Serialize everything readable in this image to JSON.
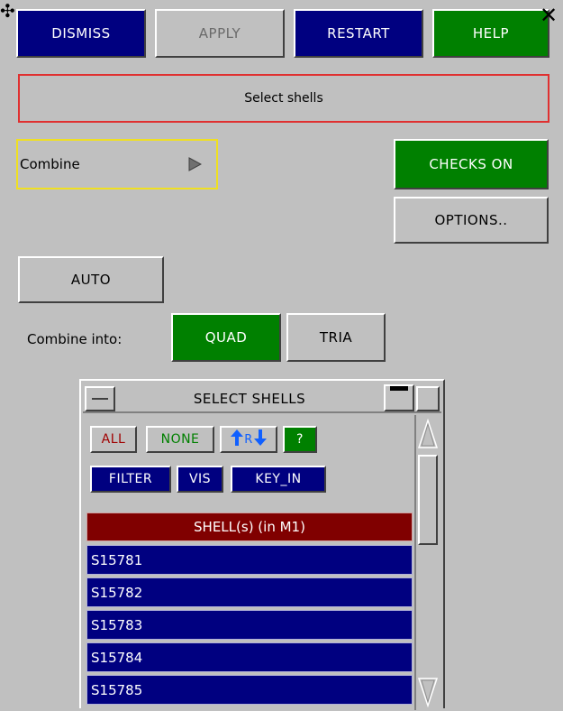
{
  "toolbar": {
    "dismiss": "DISMISS",
    "apply": "APPLY",
    "restart": "RESTART",
    "help": "HELP",
    "close_glyph": "✕",
    "move_glyph": "✣"
  },
  "header": {
    "select_shells": "Select shells"
  },
  "mode": {
    "value": "Combine"
  },
  "checks_button": "CHECKS ON",
  "options_button": "OPTIONS..",
  "auto_button": "AUTO",
  "combine": {
    "label": "Combine into:",
    "quad": "QUAD",
    "tria": "TRIA"
  },
  "selector": {
    "title": "SELECT SHELLS",
    "all": "ALL",
    "none": "NONE",
    "r_label": "R",
    "question": "?",
    "filter": "FILTER",
    "vis": "VIS",
    "key_in": "KEY_IN",
    "list_header": "SHELL(s) (in M1)",
    "items": [
      "S15781",
      "S15782",
      "S15783",
      "S15784",
      "S15785"
    ]
  },
  "colors": {
    "navy": "#000080",
    "green": "#008000",
    "panel": "#c0c0c0",
    "list_header": "#800000",
    "highlight_border": "#e03030",
    "dropdown_border": "#f0e020"
  }
}
